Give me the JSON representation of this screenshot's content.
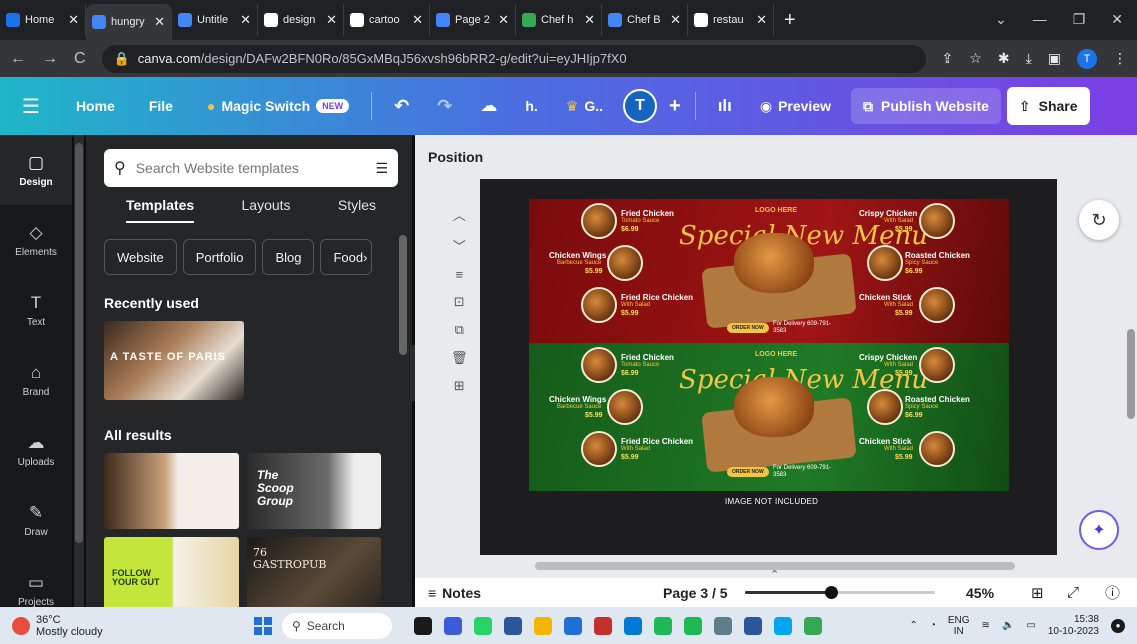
{
  "browser": {
    "tabs": [
      {
        "title": "Home",
        "color": "#1a73e8"
      },
      {
        "title": "hungry",
        "color": "#4285f4",
        "active": true
      },
      {
        "title": "Untitle",
        "color": "#4285f4"
      },
      {
        "title": "design",
        "color": "#ffffff"
      },
      {
        "title": "cartoo",
        "color": "#ffffff"
      },
      {
        "title": "Page 2",
        "color": "#4285f4"
      },
      {
        "title": "Chef h",
        "color": "#34a853"
      },
      {
        "title": "Chef B",
        "color": "#4285f4"
      },
      {
        "title": "restau",
        "color": "#ffffff"
      }
    ],
    "url_host": "canva.com",
    "url_path": "/design/DAFw2BFN0Ro/85GxMBqJ56xvsh96bRR2-g/edit?ui=eyJHIjp7fX0",
    "profile_initial": "T"
  },
  "canva": {
    "home": "Home",
    "file": "File",
    "magic_switch": "Magic Switch",
    "new_badge": "NEW",
    "h_label": "h.",
    "g_label": "G..",
    "avatar": "T",
    "preview": "Preview",
    "publish": "Publish Website",
    "share": "Share"
  },
  "rail": [
    {
      "label": "Design",
      "icon": "design-icon",
      "glyph": "▢",
      "active": true
    },
    {
      "label": "Elements",
      "icon": "elements-icon",
      "glyph": "◇"
    },
    {
      "label": "Text",
      "icon": "text-icon",
      "glyph": "T"
    },
    {
      "label": "Brand",
      "icon": "brand-icon",
      "glyph": "⌂"
    },
    {
      "label": "Uploads",
      "icon": "upload-icon",
      "glyph": "☁"
    },
    {
      "label": "Draw",
      "icon": "draw-icon",
      "glyph": "✎"
    },
    {
      "label": "Projects",
      "icon": "folder-icon",
      "glyph": "▭"
    }
  ],
  "panel": {
    "search_placeholder": "Search Website templates",
    "tabs": [
      "Templates",
      "Layouts",
      "Styles"
    ],
    "chips": [
      "Website",
      "Portfolio",
      "Blog",
      "Food"
    ],
    "recently_used": "Recently used",
    "recent_title": "A TASTE OF PARIS",
    "all_results": "All results",
    "results": [
      {
        "text": ""
      },
      {
        "text": "The Scoop Group"
      },
      {
        "text": "FOLLOW YOUR GUT"
      },
      {
        "text": "76 GASTROPUB"
      }
    ]
  },
  "editor": {
    "position_label": "Position",
    "image_note": "IMAGE NOT INCLUDED",
    "design_title": "Special New Menu",
    "items_left": [
      {
        "name": "Fried Chicken",
        "sub": "Tomato Sauce",
        "price": "$6.99"
      },
      {
        "name": "Chicken Wings",
        "sub": "Barbecue Sauce",
        "price": "$5.99"
      },
      {
        "name": "Fried Rice Chicken",
        "sub": "With Salad",
        "price": "$5.99"
      }
    ],
    "items_right": [
      {
        "name": "Crispy Chicken",
        "sub": "With Salad",
        "price": "$5.99"
      },
      {
        "name": "Roasted Chicken",
        "sub": "Spicy Sauce",
        "price": "$6.99"
      },
      {
        "name": "Chicken Stick",
        "sub": "With Salad",
        "price": "$5.99"
      }
    ],
    "order_btn": "ORDER NOW",
    "phone": "For Delivery 609-791-3583",
    "logo": "LOGO HERE"
  },
  "bottombar": {
    "notes": "Notes",
    "page": "Page 3 / 5",
    "zoom": "45%",
    "zoom_fraction": 0.45
  },
  "taskbar": {
    "temp": "36°C",
    "weather": "Mostly cloudy",
    "search": "Search",
    "lang_1": "ENG",
    "lang_2": "IN",
    "time": "15:38",
    "date": "10-10-2023",
    "apps": [
      "#1a1a1a",
      "#3b5bdb",
      "#25d366",
      "#2b579a",
      "#f4b400",
      "#1f6fd6",
      "#c4302b",
      "#0078d4",
      "#1db954",
      "#1db954",
      "#607d8b",
      "#2b579a",
      "#00a4ef",
      "#34a853"
    ]
  }
}
